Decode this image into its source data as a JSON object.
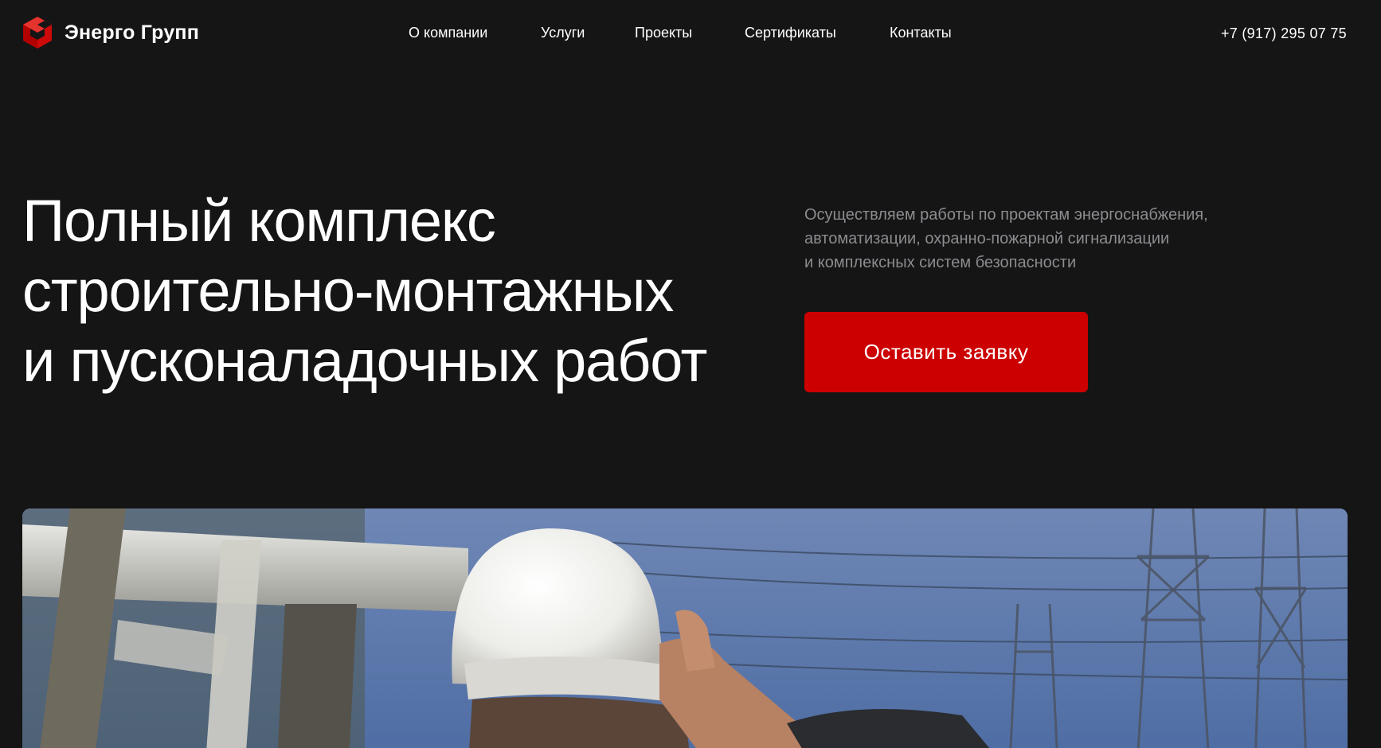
{
  "brand": {
    "name": "Энерго Групп",
    "logo_icon": "cube-logo-icon",
    "accent_color": "#cc0000"
  },
  "nav": {
    "items": [
      {
        "label": "О компании"
      },
      {
        "label": "Услуги"
      },
      {
        "label": "Проекты"
      },
      {
        "label": "Сертификаты"
      },
      {
        "label": "Контакты"
      }
    ]
  },
  "header": {
    "phone": "+7 (917) 295 07 75"
  },
  "hero": {
    "title_lines": [
      "Полный комплекс",
      "строительно-монтажных",
      "и пусконаладочных работ"
    ],
    "description_lines": [
      "Осуществляем работы по проектам энергоснабжения,",
      "автоматизации, охранно-пожарной сигнализации",
      "и комплексных систем безопасности"
    ],
    "cta_label": "Оставить заявку"
  },
  "photo": {
    "subject": "worker-hard-hat-power-lines-image"
  },
  "colors": {
    "background": "#151516",
    "text": "#ffffff",
    "muted_text": "#8c8c90",
    "button": "#cc0000"
  }
}
